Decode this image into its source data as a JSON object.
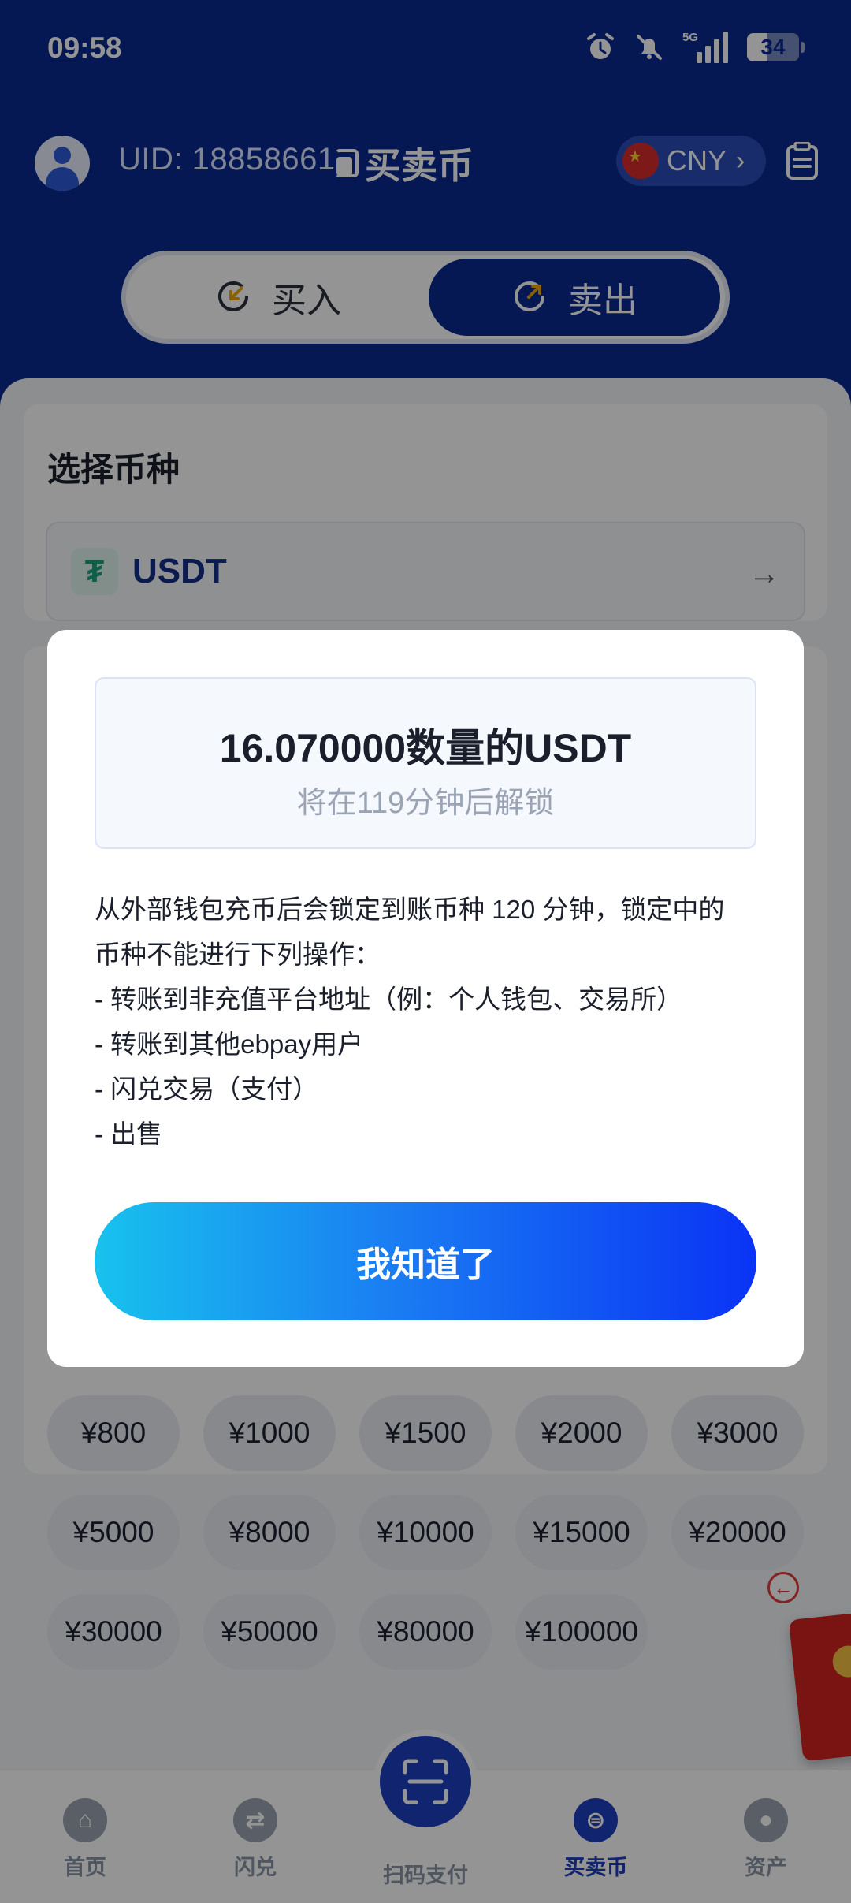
{
  "status_bar": {
    "time": "09:58",
    "network": "5G",
    "battery": "34"
  },
  "header": {
    "uid": "UID: 18858661",
    "title": "买卖币",
    "currency": "CNY"
  },
  "trade_toggle": {
    "buy_label": "买入",
    "sell_label": "卖出",
    "active": "sell"
  },
  "coin_section": {
    "label": "选择币种",
    "coin": "USDT"
  },
  "quick_amounts": [
    "¥800",
    "¥1000",
    "¥1500",
    "¥2000",
    "¥3000",
    "¥5000",
    "¥8000",
    "¥10000",
    "¥15000",
    "¥20000",
    "¥30000",
    "¥50000",
    "¥80000",
    "¥100000"
  ],
  "bottom_nav": {
    "home": "首页",
    "swap": "闪兑",
    "scan": "扫码支付",
    "trade": "买卖币",
    "assets": "资产"
  },
  "modal": {
    "amount_text": "16.070000数量的USDT",
    "unlock_text": "将在119分钟后解锁",
    "body_lines": [
      "从外部钱包充币后会锁定到账币种 120 分钟，锁定中的",
      "币种不能进行下列操作：",
      "- 转账到非充值平台地址（例：个人钱包、交易所）",
      "- 转账到其他ebpay用户",
      "- 闪兑交易（支付）",
      "- 出售"
    ],
    "button_label": "我知道了"
  },
  "colors": {
    "brand_blue": "#0b2a8f",
    "accent_blue": "#1d3fc1",
    "gradient_start": "#18c2ee",
    "gradient_end": "#0a33f5"
  }
}
